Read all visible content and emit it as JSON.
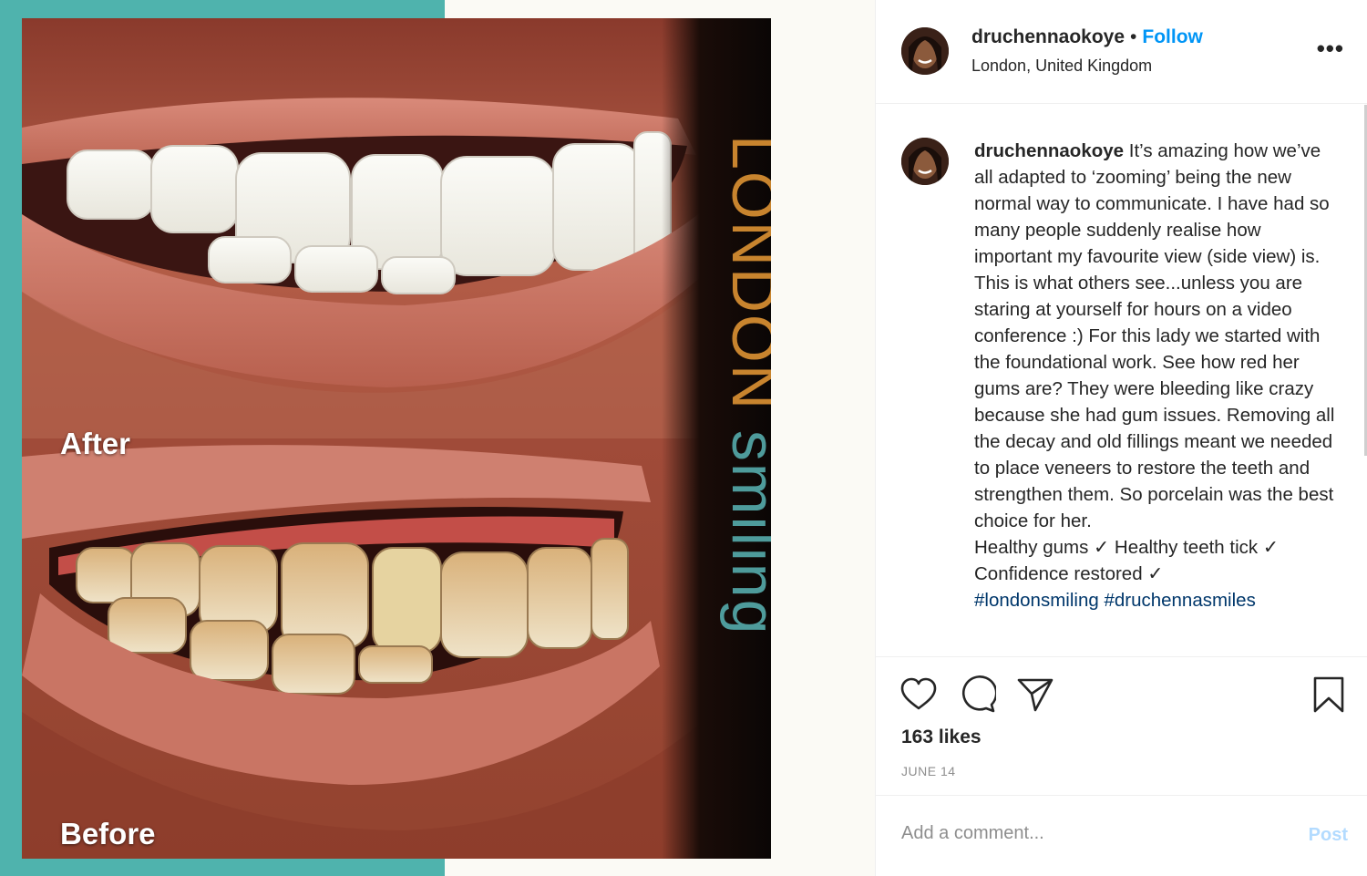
{
  "media": {
    "label_after": "After",
    "label_before": "Before",
    "brand_text": "LONDONsmiling",
    "colors": {
      "teal": "#4fb3ad",
      "gold": "#c8842e",
      "brand_teal": "#4e9b9b"
    }
  },
  "header": {
    "username": "druchennaokoye",
    "separator": "•",
    "follow_label": "Follow",
    "location": "London, United Kingdom",
    "more_label": "•••"
  },
  "caption": {
    "username": "druchennaokoye",
    "paragraph": "It’s amazing how we’ve all adapted to ‘zooming’ being the new normal way to communicate. I have had so many people suddenly realise how important my favourite view (side view) is. This is what others see...unless you are staring at yourself for hours on a video conference :) For this lady we started with the foundational work. See how red her gums are? They were bleeding like crazy because she had gum issues. Removing all the decay and old fillings meant we needed to place veneers to restore the teeth and strengthen them. So porcelain was the best choice for her.",
    "line2": "Healthy gums ✓ Healthy teeth tick ✓",
    "line3": "Confidence restored ✓",
    "hashtags": "#londonsmiling #druchennasmiles"
  },
  "actions": {
    "icons": [
      "heart-icon",
      "comment-icon",
      "share-icon",
      "bookmark-icon"
    ],
    "likes": "163 likes",
    "date": "JUNE 14"
  },
  "comment": {
    "placeholder": "Add a comment...",
    "post_label": "Post"
  }
}
